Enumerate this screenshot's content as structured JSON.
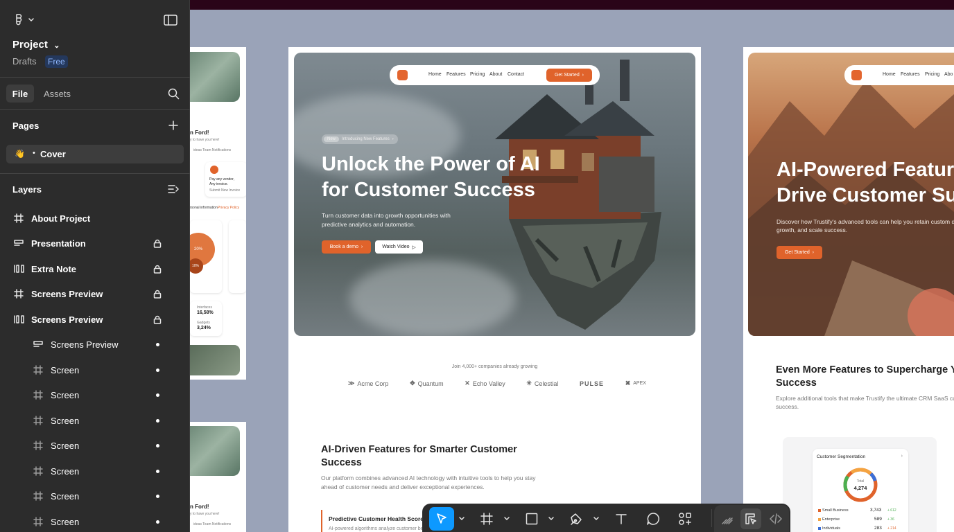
{
  "sidebar": {
    "project_title": "Project",
    "drafts_label": "Drafts",
    "plan_badge": "Free",
    "tabs": {
      "file": "File",
      "assets": "Assets"
    },
    "pages_heading": "Pages",
    "pages": [
      {
        "emoji": "👋",
        "bullet": "•",
        "label": "Cover"
      }
    ],
    "layers_heading": "Layers",
    "layers": [
      {
        "icon": "frame-icon",
        "label": "About Project",
        "locked": false
      },
      {
        "icon": "section-icon",
        "label": "Presentation",
        "locked": true
      },
      {
        "icon": "columns-icon",
        "label": "Extra Note",
        "locked": true
      },
      {
        "icon": "frame-icon",
        "label": "Screens Preview",
        "locked": true
      },
      {
        "icon": "columns-icon",
        "label": "Screens Preview",
        "locked": true
      },
      {
        "icon": "section-icon",
        "label": "Screens Preview",
        "child": true
      },
      {
        "icon": "frame-icon",
        "label": "Screen",
        "child": true
      },
      {
        "icon": "frame-icon",
        "label": "Screen",
        "child": true
      },
      {
        "icon": "frame-icon",
        "label": "Screen",
        "child": true
      },
      {
        "icon": "frame-icon",
        "label": "Screen",
        "child": true
      },
      {
        "icon": "frame-icon",
        "label": "Screen",
        "child": true
      },
      {
        "icon": "frame-icon",
        "label": "Screen",
        "child": true
      },
      {
        "icon": "frame-icon",
        "label": "Screen",
        "child": true
      }
    ]
  },
  "canvas": {
    "main_frame": {
      "nav": [
        "Home",
        "Features",
        "Pricing",
        "About",
        "Contact"
      ],
      "nav_cta": "Get Started",
      "pill_new": "New",
      "pill_text": "Introducing New Features",
      "hero_title": "Unlock the Power of AI for Customer Success",
      "hero_text": "Turn customer data into growth opportunities with predictive analytics and automation.",
      "btn_book": "Book a demo",
      "btn_watch": "Watch Video",
      "join_text": "Join 4,000+ companies already growing",
      "brands": [
        "Acme Corp",
        "Quantum",
        "Echo Valley",
        "Celestial",
        "PULSE",
        "APEX"
      ],
      "section_title": "AI-Driven Features for Smarter Customer Success",
      "section_text": "Our platform combines advanced AI technology with intuitive tools to help you stay ahead of customer needs and deliver exceptional experiences.",
      "feature_title": "Predictive Customer Health Scores",
      "feature_text": "AI-powered algorithms analyze customer be"
    },
    "right_frame": {
      "nav": [
        "Home",
        "Features",
        "Pricing",
        "Abo"
      ],
      "hero_title_1": "AI-Powered Featur",
      "hero_title_2": "Drive Customer Su",
      "hero_text": "Discover how Trustify's advanced tools can help you retain custom drive growth, and scale success.",
      "cta": "Get Started",
      "section_title_1": "Even More Features to Supercharge Y",
      "section_title_2": "Success",
      "section_text": "Explore additional tools that make Trustify the ultimate CRM SaaS customer success.",
      "card_title": "Customer Segmentation",
      "donut_label": "Total",
      "donut_value": "4,274",
      "rows": [
        {
          "label": "Small Business",
          "value": "3,743",
          "change": "+ 612",
          "color": "#e0632b"
        },
        {
          "label": "Enterprise",
          "value": "589",
          "change": "+ 36",
          "color": "#f4a340"
        },
        {
          "label": "Individuals",
          "value": "283",
          "change": "+ 214",
          "color": "#3b6fd8"
        }
      ]
    },
    "left_frame": {
      "greeting": "n Ford!",
      "greeting_sub": "y to have you here!",
      "tabs": "ideas  Team  Notifications",
      "vendor_line1": "Pay any vendor,",
      "vendor_line2": "Any invoice.",
      "vendor_link": "Submit New Invoice",
      "info": "rsonal information",
      "privacy": "Privacy Policy",
      "pct1": "20%",
      "pct2": "10%",
      "stat1_label": "Interfaces",
      "stat1_value": "16,58%",
      "stat2_label": "Gadgets",
      "stat2_value": "3,24%",
      "greeting_b": "n Ford!",
      "greeting_b_sub": "y to have you here!",
      "tabs_b": "ideas  Team  Notifications"
    }
  },
  "colors": {
    "accent": "#e0632b",
    "sidebar_bg": "#2c2c2c",
    "canvas_bg": "#9aa3b8",
    "select_blue": "#0d99ff"
  }
}
